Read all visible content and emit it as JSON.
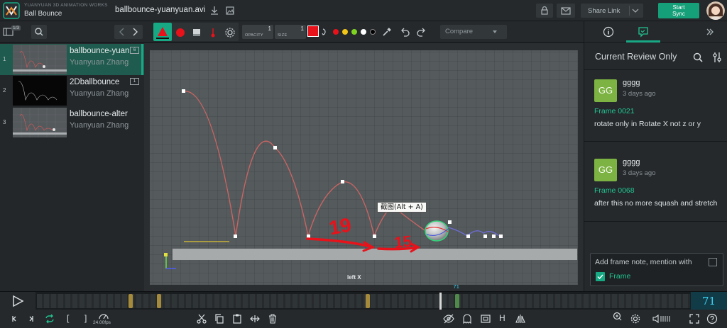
{
  "header": {
    "studio": "YUANYUAN 3D ANIMATION WORKS",
    "project": "Ball Bounce",
    "filename": "ballbounce-yuanyuan.avi",
    "share_label": "Share Link",
    "start_sync_line1": "Start",
    "start_sync_line2": "Sync"
  },
  "toolbar": {
    "video_count": "1/3",
    "opacity_label": "OPACITY",
    "opacity_value": "1",
    "size_label": "SIZE",
    "size_value": "1",
    "color": "#e8121b",
    "palette": [
      "#e8121b",
      "#f2c617",
      "#7ed321",
      "#ffffff",
      "#000000"
    ],
    "compare_label": "Compare"
  },
  "playlist": [
    {
      "num": "1",
      "title": "ballbounce-yuanyuan",
      "author": "Yuanyuan Zhang",
      "badge": "6"
    },
    {
      "num": "2",
      "title": "2Dballbounce",
      "author": "Yuanyuan Zhang",
      "badge": "1"
    },
    {
      "num": "3",
      "title": "ballbounce-alter",
      "author": "Yuanyuan Zhang",
      "badge": ""
    }
  ],
  "viewer": {
    "tooltip": "截图(Alt + A)",
    "view_label": "left X",
    "annotation_1": "19",
    "annotation_2": "15"
  },
  "review": {
    "title": "Current Review Only",
    "comments": [
      {
        "initials": "GG",
        "name": "gggg",
        "time": "3 days ago",
        "frame": "Frame 0021",
        "text": "rotate only in Rotate X not z or y"
      },
      {
        "initials": "GG",
        "name": "gggg",
        "time": "3 days ago",
        "frame": "Frame 0068",
        "text": "after this no more squash and stretch"
      }
    ],
    "note_placeholder": "Add frame note, mention with",
    "note_frame_label": "Frame"
  },
  "timeline": {
    "current_frame": "71",
    "playhead_label": "71",
    "fps": "24.00fps",
    "markers": [
      0.14,
      0.184,
      0.503,
      0.64
    ]
  },
  "bottom": {
    "h_label": "H",
    "bracket_in": "[",
    "bracket_out": "]"
  },
  "colors": {
    "accent": "#17a884",
    "frame_text": "#22c48f",
    "annotation": "#e8121b"
  }
}
